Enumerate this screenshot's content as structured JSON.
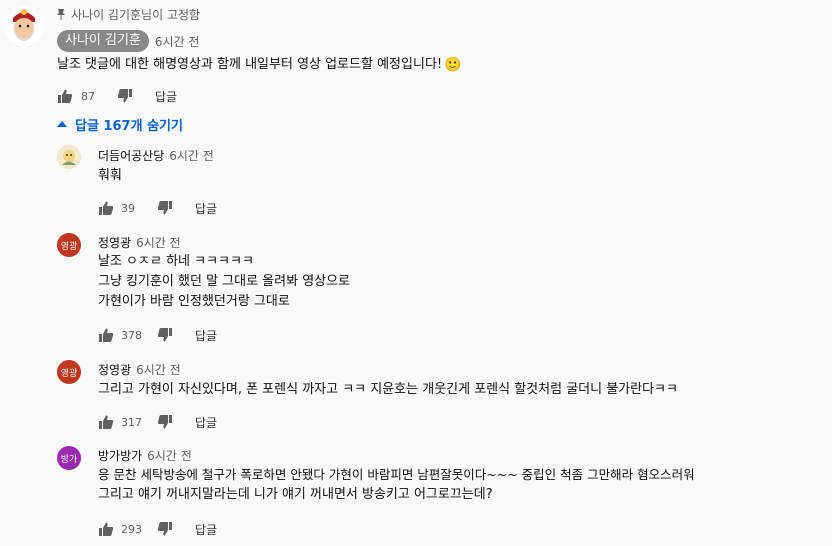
{
  "pinned": {
    "label": "사나이 김기훈님이 고정함"
  },
  "main_comment": {
    "author": "사나이 김기훈",
    "time": "6시간 전",
    "text": "날조 댓글에 대한 해명영상과 함께 내일부터 영상 업로드할 예정입니다!",
    "emoji": "🙂",
    "likes": "87",
    "reply_label": "답글"
  },
  "replies_toggle": {
    "label": "답글 167개 숨기기",
    "color": "#065fd4"
  },
  "replies": [
    {
      "author": "더듬어공산당",
      "time": "6시간 전",
      "lines": [
        "훠훠"
      ],
      "likes": "39",
      "reply_label": "답글"
    },
    {
      "author": "정영광",
      "avatar_text": "영광",
      "avatar_color": "#c0361e",
      "time": "6시간 전",
      "lines": [
        "날조 ㅇㅈㄹ 하네 ㅋㅋㅋㅋㅋ",
        "그냥 킹기훈이 했던 말 그대로 올려봐 영상으로",
        "가현이가 바람 인정했던거랑 그대로"
      ],
      "likes": "378",
      "reply_label": "답글"
    },
    {
      "author": "정영광",
      "avatar_text": "영광",
      "avatar_color": "#c0361e",
      "time": "6시간 전",
      "lines": [
        "그리고 가현이 자신있다며, 폰 포렌식 까자고 ㅋㅋ 지윤호는 개웃긴게 포렌식 할것처럼 굴더니 불가란다ㅋㅋ"
      ],
      "likes": "317",
      "reply_label": "답글"
    },
    {
      "author": "방가방가",
      "avatar_text": "방가",
      "avatar_color": "#9c27b0",
      "time": "6시간 전",
      "lines": [
        "응 문찬 세탁방송에 철구가 폭로하면 안됐다 가현이 바람피면 남편잘못이다~~~ 중립인 척좀 그만해라 혐오스러워",
        "그리고 얘기 꺼내지말라는데 니가 얘기 꺼내면서 방송키고 어그로끄는데?"
      ],
      "likes": "293",
      "reply_label": "답글"
    }
  ]
}
